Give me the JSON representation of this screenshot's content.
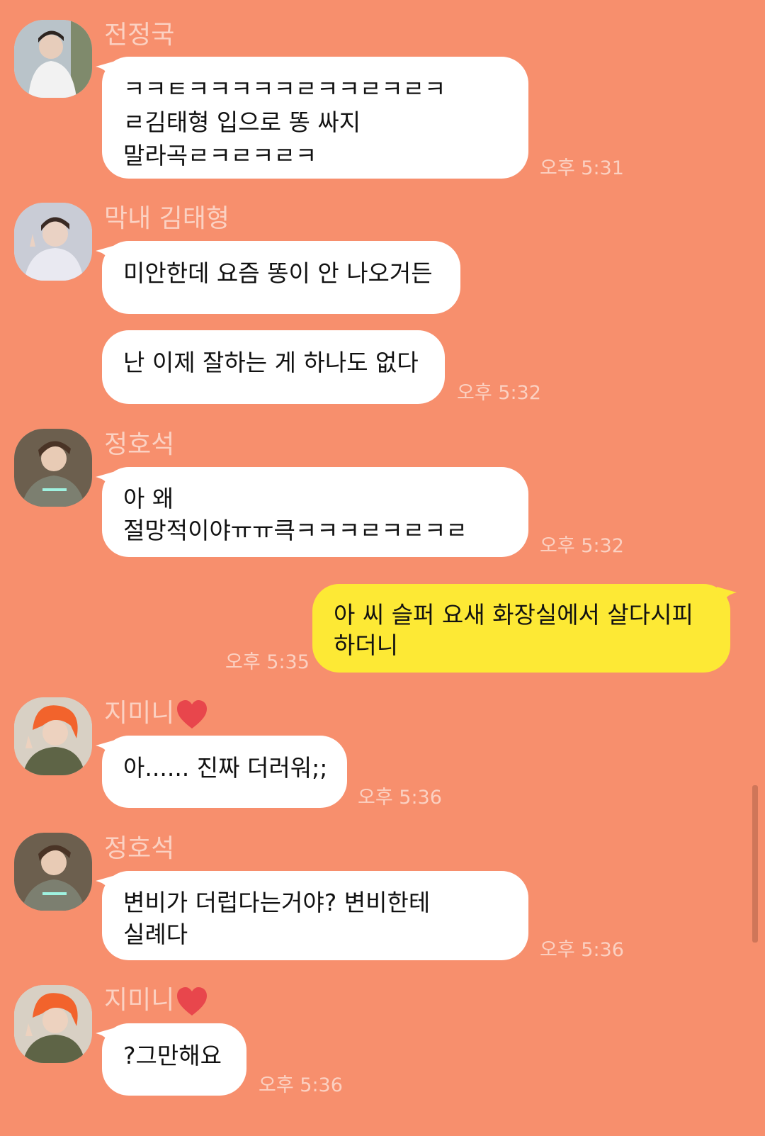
{
  "messages": [
    {
      "sender": "전정국",
      "lines": [
        "ㅋㅋㅌㅋㅋㅋㅋㅋㄹㅋㅋㄹㅋㄹㅋ",
        "ㄹ김태형 입으로 똥 싸지",
        "말라곡ㄹㅋㄹㅋㄹㅋ"
      ],
      "time": "오후 5:31"
    },
    {
      "sender": "막내 김태형",
      "lines": [
        "미안한데 요즘 똥이 안 나오거든"
      ],
      "time": ""
    },
    {
      "sender": "",
      "lines": [
        "난 이제 잘하는 게 하나도 없다"
      ],
      "time": "오후 5:32"
    },
    {
      "sender": "정호석",
      "lines": [
        "아 왜",
        "절망적이야ㅠㅠ큭ㅋㅋㅋㄹㅋㄹㅋㄹ"
      ],
      "time": "오후 5:32"
    },
    {
      "sender": "me",
      "lines": [
        "아 씨 슬퍼 요새 화장실에서 살다시피",
        "하더니"
      ],
      "time": "오후 5:35"
    },
    {
      "sender": "지미니",
      "lines": [
        "아...... 진짜 더러워;;"
      ],
      "time": "오후 5:36"
    },
    {
      "sender": "정호석",
      "lines": [
        "변비가 더럽다는거야? 변비한테",
        "실례다"
      ],
      "time": "오후 5:36"
    },
    {
      "sender": "지미니",
      "lines": [
        "?그만해요"
      ],
      "time": "오후 5:36"
    }
  ],
  "colors": {
    "background": "#f78f6d",
    "bubble_other": "#ffffff",
    "bubble_mine": "#fde935",
    "name_text": "#fbd1c2",
    "time_text": "#fbd1c2",
    "heart": "#e8464c"
  },
  "icons": {
    "heart": "heart-emoji-icon"
  }
}
